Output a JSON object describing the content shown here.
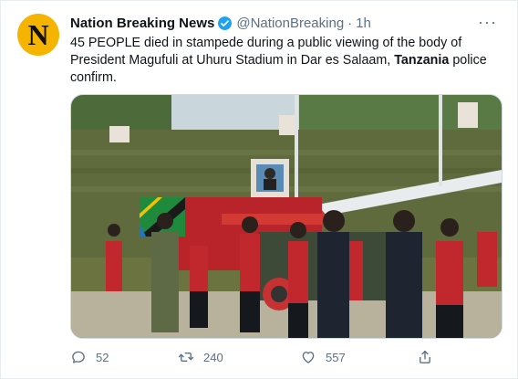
{
  "tweet": {
    "author_name": "Nation Breaking News",
    "handle": "@NationBreaking",
    "separator": "·",
    "time": "1h",
    "avatar_letter": "N",
    "text_before": "45 PEOPLE died in stampede during a public viewing of the body of President Magufuli at Uhuru Stadium in Dar es Salaam, ",
    "text_bold": "Tanzania",
    "text_after": " police confirm.",
    "more_label": "···"
  },
  "actions": {
    "reply_count": "52",
    "retweet_count": "240",
    "like_count": "557"
  },
  "icons": {
    "verified": "verified-badge-icon",
    "more": "more-options-icon",
    "reply": "reply-icon",
    "retweet": "retweet-icon",
    "like": "like-icon",
    "share": "share-icon"
  },
  "colors": {
    "verified": "#1da1f2",
    "avatar_bg": "#f4b400",
    "secondary_text": "#5b7083"
  }
}
